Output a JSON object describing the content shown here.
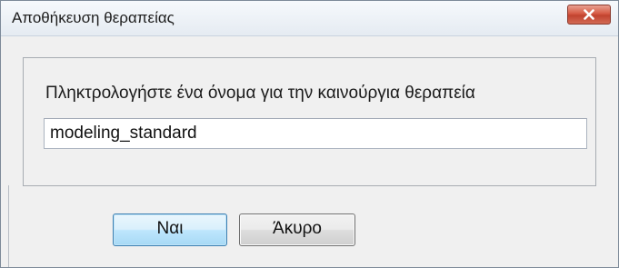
{
  "window": {
    "title": "Αποθήκευση θεραπείας",
    "close_icon": "close-x-icon"
  },
  "form": {
    "prompt": "Πληκτρολογήστε ένα όνομα για την καινούργια θεραπεία",
    "name_value": "modeling_standard"
  },
  "buttons": {
    "yes_label": "Ναι",
    "cancel_label": "Άκυρο"
  },
  "colors": {
    "close_button": "#c1432f",
    "default_button_border": "#3c7fb1"
  }
}
